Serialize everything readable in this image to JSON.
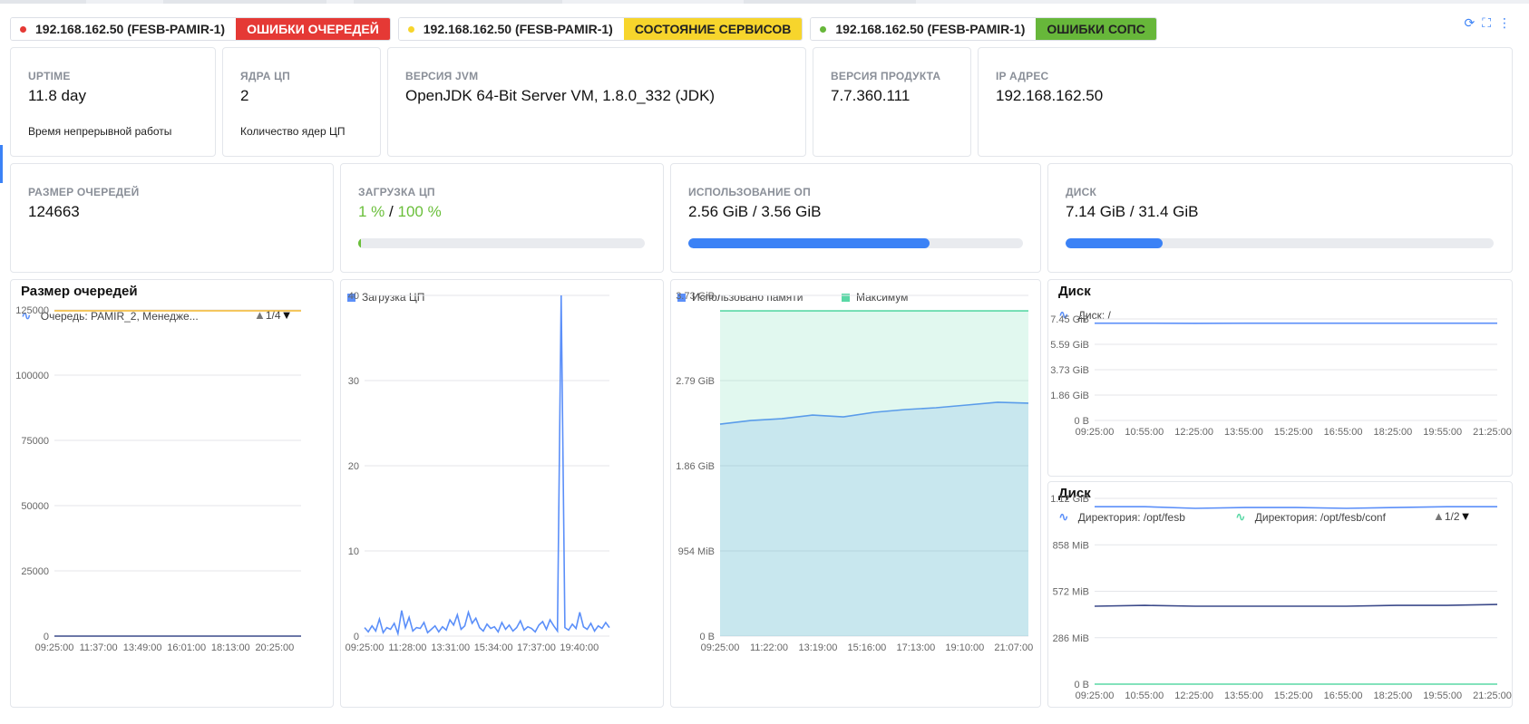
{
  "tabs": [
    {
      "host": "192.168.162.50 (FESB-PAMIR-1)",
      "status": "ОШИБКИ ОЧЕРЕДЕЙ",
      "dot_color": "#e53935",
      "status_bg": "#e53935",
      "status_fg": "#ffffff"
    },
    {
      "host": "192.168.162.50 (FESB-PAMIR-1)",
      "status": "СОСТОЯНИЕ СЕРВИСОВ",
      "dot_color": "#f7d52c",
      "status_bg": "#f7d52c",
      "status_fg": "#222222"
    },
    {
      "host": "192.168.162.50 (FESB-PAMIR-1)",
      "status": "ОШИБКИ СОПС",
      "dot_color": "#67b73a",
      "status_bg": "#67b73a",
      "status_fg": "#222222"
    }
  ],
  "tools": {
    "refresh_icon": "refresh-icon",
    "fullscreen_icon": "fullscreen-icon",
    "more_icon": "more-vertical-icon",
    "refresh": "⟳",
    "fullscreen": "⛶",
    "more": "⋮"
  },
  "info": {
    "uptime": {
      "label": "UPTIME",
      "value": "11.8 day",
      "sub": "Время непрерывной работы"
    },
    "cores": {
      "label": "ЯДРА ЦП",
      "value": "2",
      "sub": "Количество ядер ЦП"
    },
    "jvm": {
      "label": "ВЕРСИЯ JVM",
      "value": "OpenJDK 64-Bit Server VM, 1.8.0_332 (JDK)"
    },
    "product": {
      "label": "ВЕРСИЯ ПРОДУКТА",
      "value": "7.7.360.111"
    },
    "ip": {
      "label": "IP АДРЕС",
      "value": "192.168.162.50"
    }
  },
  "stats": {
    "queue": {
      "label": "РАЗМЕР ОЧЕРЕДЕЙ",
      "value": "124663"
    },
    "cpu": {
      "label": "ЗАГРУЗКА ЦП",
      "used": "1 %",
      "sep": "/",
      "total": "100 %",
      "fraction": 0.01
    },
    "mem": {
      "label": "ИСПОЛЬЗОВАНИЕ ОП",
      "used": "2.56 GiB",
      "sep": "/",
      "total": "3.56 GiB",
      "fraction": 0.72
    },
    "disk": {
      "label": "ДИСК",
      "used": "7.14 GiB",
      "sep": "/",
      "total": "31.4 GiB",
      "fraction": 0.227
    }
  },
  "panels": {
    "queue": {
      "title": "Размер очередей",
      "legend": "Очередь: PAMIR_2, Менедже...",
      "pager": "1/4"
    },
    "cpu": {
      "legend": "Загрузка ЦП"
    },
    "mem": {
      "legend1": "Использовано памяти",
      "legend2": "Максимум"
    },
    "disk1": {
      "title": "Диск",
      "legend": "Диск: /"
    },
    "disk2": {
      "title": "Диск",
      "legend1": "Директория: /opt/fesb",
      "legend2": "Директория: /opt/fesb/conf",
      "pager": "1/2"
    }
  },
  "chart_data": [
    {
      "type": "line",
      "title": "Размер очередей",
      "x": [
        "09:25:00",
        "11:37:00",
        "13:49:00",
        "16:01:00",
        "18:13:00",
        "20:25:00"
      ],
      "y_ticks": [
        "0",
        "25000",
        "50000",
        "75000",
        "100000",
        "125000"
      ],
      "ylim": [
        0,
        125000
      ],
      "series": [
        {
          "name": "Очередь: PAMIR_2, Менедже...",
          "color": "#f5b82e",
          "values": [
            124663,
            124663,
            124663,
            124663,
            124663,
            124663
          ]
        },
        {
          "color": "#3c4a8a",
          "values": [
            0,
            0,
            0,
            0,
            0,
            0
          ]
        }
      ]
    },
    {
      "type": "line",
      "x": [
        "09:25:00",
        "11:28:00",
        "13:31:00",
        "15:34:00",
        "17:37:00",
        "19:40:00"
      ],
      "y_ticks": [
        "0",
        "10",
        "20",
        "30",
        "40"
      ],
      "ylim": [
        0,
        40
      ],
      "series": [
        {
          "name": "Загрузка ЦП",
          "color": "#5b8ff9",
          "values": [
            1,
            0.5,
            1.2,
            0.6,
            2,
            0.4,
            1,
            0.8,
            1.5,
            0.3,
            3,
            1,
            2.2,
            0.6,
            1,
            0.9,
            1.6,
            0.4,
            0.8,
            1.2,
            0.5,
            1.1,
            0.7,
            1.9,
            1.3,
            2.5,
            0.8,
            1.2,
            2.8,
            1.5,
            2.1,
            1,
            0.6,
            1.4,
            0.9,
            1.1,
            0.5,
            1.6,
            0.8,
            1.3,
            0.6,
            1,
            1.8,
            0.7,
            1.1,
            0.9,
            0.5,
            1.3,
            1.7,
            0.8,
            1.9,
            1.2,
            0.6,
            40,
            1,
            0.7,
            1.4,
            0.9,
            2.8,
            1.1,
            0.8,
            1.5,
            0.6,
            1.2,
            0.9,
            1.6,
            1
          ]
        }
      ]
    },
    {
      "type": "area",
      "x": [
        "09:25:00",
        "11:22:00",
        "13:19:00",
        "15:16:00",
        "17:13:00",
        "19:10:00",
        "21:07:00"
      ],
      "y_ticks": [
        "0 B",
        "954 MiB",
        "1.86 GiB",
        "2.79 GiB",
        "3.73 GiB"
      ],
      "ylim": [
        0,
        3.73
      ],
      "series": [
        {
          "name": "Использовано памяти",
          "color": "#5b8ff9",
          "values": [
            2.32,
            2.36,
            2.38,
            2.42,
            2.4,
            2.45,
            2.48,
            2.5,
            2.53,
            2.56,
            2.55
          ]
        },
        {
          "name": "Максимум",
          "color": "#5ad8a6",
          "values": [
            3.56,
            3.56,
            3.56,
            3.56,
            3.56,
            3.56,
            3.56,
            3.56,
            3.56,
            3.56,
            3.56
          ]
        }
      ]
    },
    {
      "type": "line",
      "title": "Диск",
      "x": [
        "09:25:00",
        "10:55:00",
        "12:25:00",
        "13:55:00",
        "15:25:00",
        "16:55:00",
        "18:25:00",
        "19:55:00",
        "21:25:00"
      ],
      "y_ticks": [
        "0 B",
        "1.86 GiB",
        "3.73 GiB",
        "5.59 GiB",
        "7.45 GiB"
      ],
      "ylim": [
        0,
        7.45
      ],
      "series": [
        {
          "name": "Диск: /",
          "color": "#5b8ff9",
          "values": [
            7.14,
            7.14,
            7.13,
            7.14,
            7.14,
            7.14,
            7.14,
            7.14,
            7.14
          ]
        }
      ]
    },
    {
      "type": "line",
      "title": "Диск",
      "x": [
        "09:25:00",
        "10:55:00",
        "12:25:00",
        "13:55:00",
        "15:25:00",
        "16:55:00",
        "18:25:00",
        "19:55:00",
        "21:25:00"
      ],
      "y_ticks": [
        "0 B",
        "286 MiB",
        "572 MiB",
        "858 MiB",
        "1.12 GiB"
      ],
      "ylim": [
        0,
        1.12
      ],
      "series": [
        {
          "name": "Директория: /opt/fesb",
          "color": "#5b8ff9",
          "values": [
            1.07,
            1.07,
            1.06,
            1.065,
            1.065,
            1.06,
            1.065,
            1.07,
            1.07
          ]
        },
        {
          "name": "Директория: /opt/fesb/conf",
          "color": "#5ad8a6",
          "values": [
            0,
            0,
            0,
            0,
            0,
            0,
            0,
            0,
            0
          ]
        },
        {
          "color": "#3c4a8a",
          "values": [
            0.47,
            0.475,
            0.47,
            0.47,
            0.47,
            0.47,
            0.475,
            0.475,
            0.48
          ]
        }
      ]
    }
  ]
}
